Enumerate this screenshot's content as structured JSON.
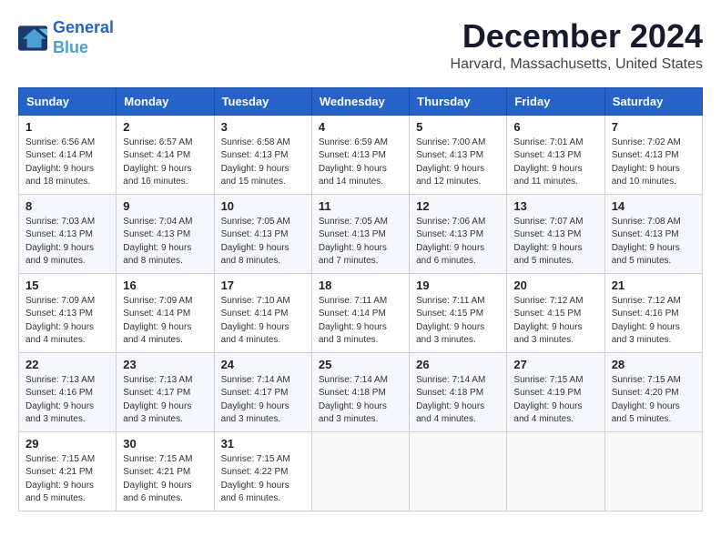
{
  "header": {
    "logo_line1": "General",
    "logo_line2": "Blue",
    "month_title": "December 2024",
    "location": "Harvard, Massachusetts, United States"
  },
  "days_of_week": [
    "Sunday",
    "Monday",
    "Tuesday",
    "Wednesday",
    "Thursday",
    "Friday",
    "Saturday"
  ],
  "weeks": [
    [
      {
        "day": "1",
        "sunrise": "6:56 AM",
        "sunset": "4:14 PM",
        "daylight": "9 hours and 18 minutes."
      },
      {
        "day": "2",
        "sunrise": "6:57 AM",
        "sunset": "4:14 PM",
        "daylight": "9 hours and 16 minutes."
      },
      {
        "day": "3",
        "sunrise": "6:58 AM",
        "sunset": "4:13 PM",
        "daylight": "9 hours and 15 minutes."
      },
      {
        "day": "4",
        "sunrise": "6:59 AM",
        "sunset": "4:13 PM",
        "daylight": "9 hours and 14 minutes."
      },
      {
        "day": "5",
        "sunrise": "7:00 AM",
        "sunset": "4:13 PM",
        "daylight": "9 hours and 12 minutes."
      },
      {
        "day": "6",
        "sunrise": "7:01 AM",
        "sunset": "4:13 PM",
        "daylight": "9 hours and 11 minutes."
      },
      {
        "day": "7",
        "sunrise": "7:02 AM",
        "sunset": "4:13 PM",
        "daylight": "9 hours and 10 minutes."
      }
    ],
    [
      {
        "day": "8",
        "sunrise": "7:03 AM",
        "sunset": "4:13 PM",
        "daylight": "9 hours and 9 minutes."
      },
      {
        "day": "9",
        "sunrise": "7:04 AM",
        "sunset": "4:13 PM",
        "daylight": "9 hours and 8 minutes."
      },
      {
        "day": "10",
        "sunrise": "7:05 AM",
        "sunset": "4:13 PM",
        "daylight": "9 hours and 8 minutes."
      },
      {
        "day": "11",
        "sunrise": "7:05 AM",
        "sunset": "4:13 PM",
        "daylight": "9 hours and 7 minutes."
      },
      {
        "day": "12",
        "sunrise": "7:06 AM",
        "sunset": "4:13 PM",
        "daylight": "9 hours and 6 minutes."
      },
      {
        "day": "13",
        "sunrise": "7:07 AM",
        "sunset": "4:13 PM",
        "daylight": "9 hours and 5 minutes."
      },
      {
        "day": "14",
        "sunrise": "7:08 AM",
        "sunset": "4:13 PM",
        "daylight": "9 hours and 5 minutes."
      }
    ],
    [
      {
        "day": "15",
        "sunrise": "7:09 AM",
        "sunset": "4:13 PM",
        "daylight": "9 hours and 4 minutes."
      },
      {
        "day": "16",
        "sunrise": "7:09 AM",
        "sunset": "4:14 PM",
        "daylight": "9 hours and 4 minutes."
      },
      {
        "day": "17",
        "sunrise": "7:10 AM",
        "sunset": "4:14 PM",
        "daylight": "9 hours and 4 minutes."
      },
      {
        "day": "18",
        "sunrise": "7:11 AM",
        "sunset": "4:14 PM",
        "daylight": "9 hours and 3 minutes."
      },
      {
        "day": "19",
        "sunrise": "7:11 AM",
        "sunset": "4:15 PM",
        "daylight": "9 hours and 3 minutes."
      },
      {
        "day": "20",
        "sunrise": "7:12 AM",
        "sunset": "4:15 PM",
        "daylight": "9 hours and 3 minutes."
      },
      {
        "day": "21",
        "sunrise": "7:12 AM",
        "sunset": "4:16 PM",
        "daylight": "9 hours and 3 minutes."
      }
    ],
    [
      {
        "day": "22",
        "sunrise": "7:13 AM",
        "sunset": "4:16 PM",
        "daylight": "9 hours and 3 minutes."
      },
      {
        "day": "23",
        "sunrise": "7:13 AM",
        "sunset": "4:17 PM",
        "daylight": "9 hours and 3 minutes."
      },
      {
        "day": "24",
        "sunrise": "7:14 AM",
        "sunset": "4:17 PM",
        "daylight": "9 hours and 3 minutes."
      },
      {
        "day": "25",
        "sunrise": "7:14 AM",
        "sunset": "4:18 PM",
        "daylight": "9 hours and 3 minutes."
      },
      {
        "day": "26",
        "sunrise": "7:14 AM",
        "sunset": "4:18 PM",
        "daylight": "9 hours and 4 minutes."
      },
      {
        "day": "27",
        "sunrise": "7:15 AM",
        "sunset": "4:19 PM",
        "daylight": "9 hours and 4 minutes."
      },
      {
        "day": "28",
        "sunrise": "7:15 AM",
        "sunset": "4:20 PM",
        "daylight": "9 hours and 5 minutes."
      }
    ],
    [
      {
        "day": "29",
        "sunrise": "7:15 AM",
        "sunset": "4:21 PM",
        "daylight": "9 hours and 5 minutes."
      },
      {
        "day": "30",
        "sunrise": "7:15 AM",
        "sunset": "4:21 PM",
        "daylight": "9 hours and 6 minutes."
      },
      {
        "day": "31",
        "sunrise": "7:15 AM",
        "sunset": "4:22 PM",
        "daylight": "9 hours and 6 minutes."
      },
      null,
      null,
      null,
      null
    ]
  ],
  "labels": {
    "sunrise_prefix": "Sunrise: ",
    "sunset_prefix": "Sunset: ",
    "daylight_prefix": "Daylight: "
  }
}
